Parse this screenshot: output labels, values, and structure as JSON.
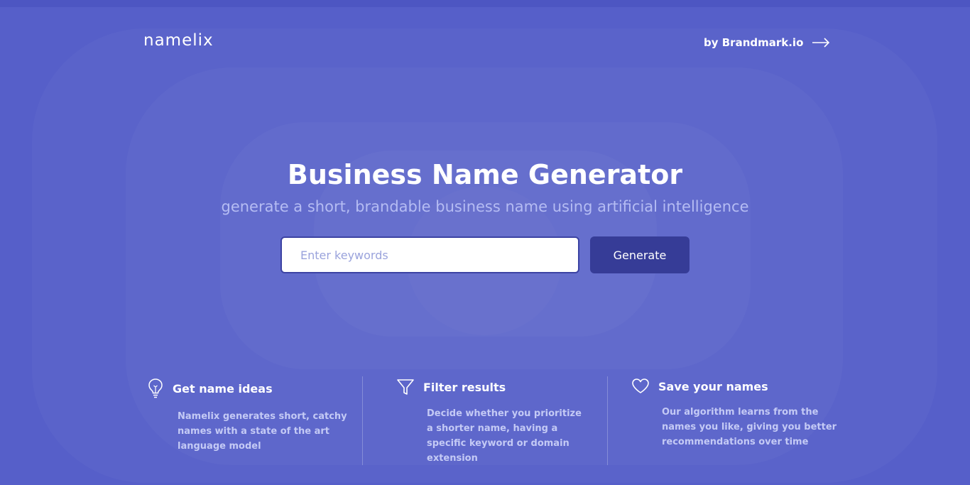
{
  "header": {
    "logo": "namelix",
    "brandmark_link": "by Brandmark.io"
  },
  "hero": {
    "title": "Business Name Generator",
    "subtitle": "generate a short, brandable business name using artificial intelligence"
  },
  "search": {
    "placeholder": "Enter keywords",
    "value": "",
    "button_label": "Generate"
  },
  "features": [
    {
      "icon": "lightbulb-icon",
      "title": "Get name ideas",
      "desc_lines": [
        "Namelix generates short, catchy",
        "names with a state of the art",
        "language model"
      ]
    },
    {
      "icon": "filter-icon",
      "title": "Filter results",
      "desc_lines": [
        "Decide whether you prioritize",
        "a shorter name, having a",
        "specific keyword or domain",
        "extension"
      ]
    },
    {
      "icon": "heart-icon",
      "title": "Save your names",
      "desc_lines": [
        "Our algorithm learns from the",
        "names you like, giving you better",
        "recommendations over time"
      ]
    }
  ],
  "colors": {
    "background": "#565fc9",
    "button": "#363c97",
    "subtitle": "#b5bcf3"
  }
}
